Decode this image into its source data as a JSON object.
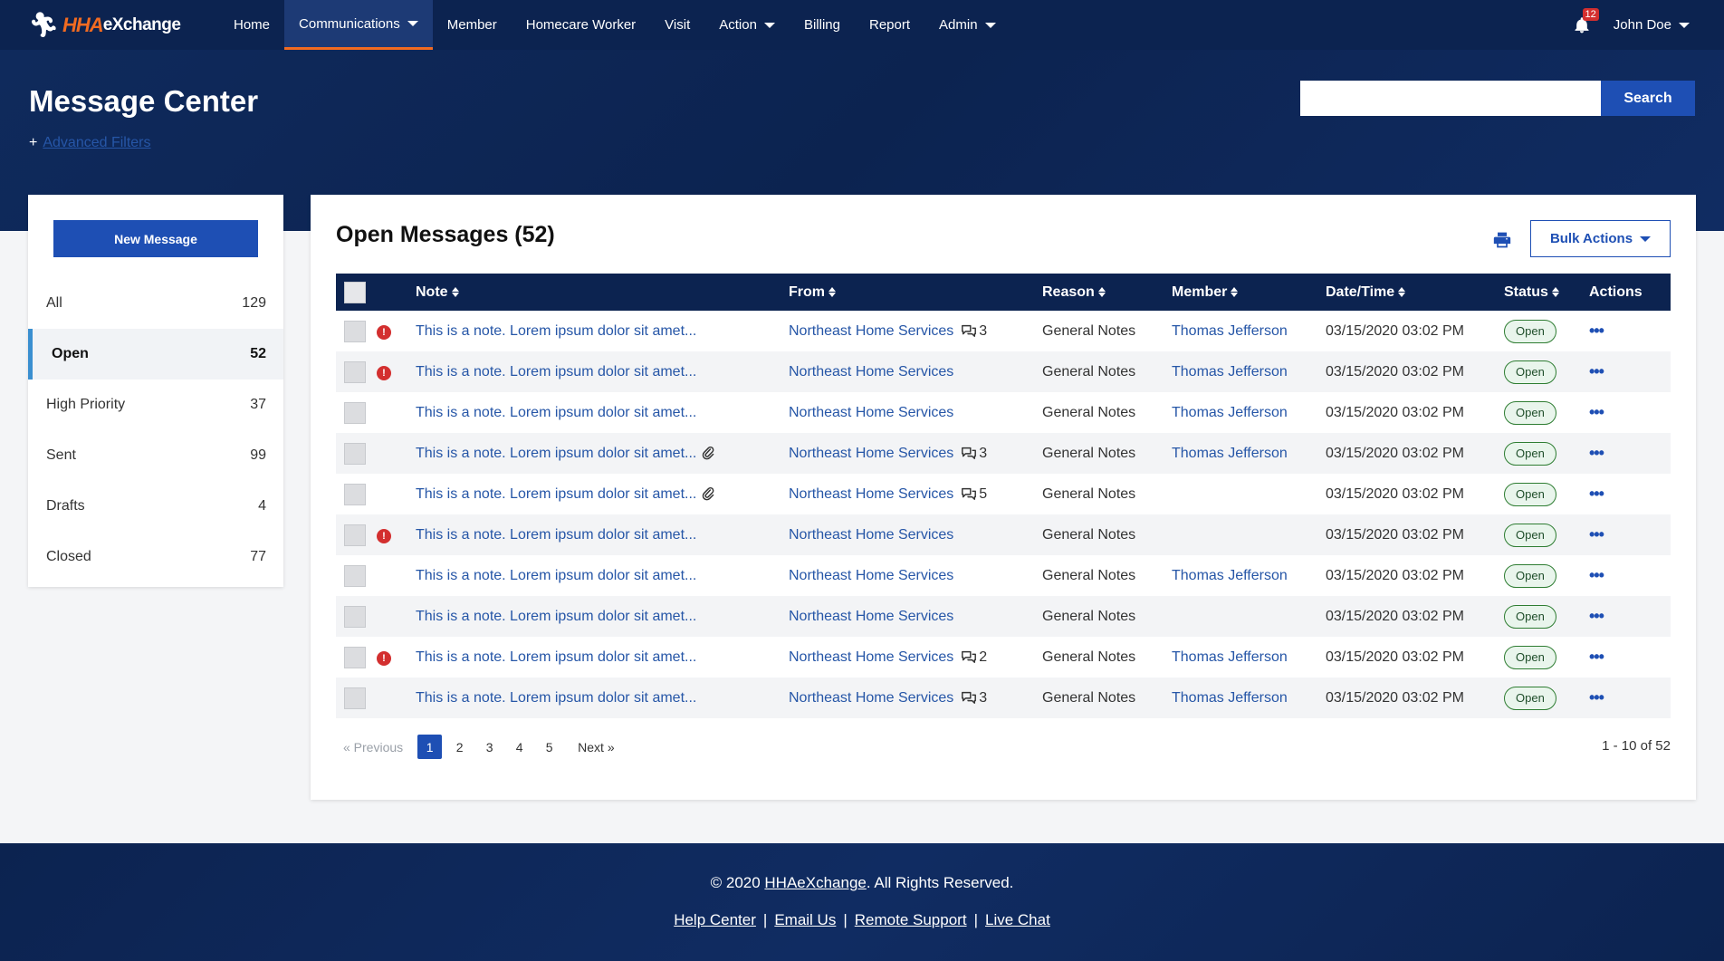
{
  "brand": {
    "part1": "HHA",
    "part2": "eXchange"
  },
  "nav": {
    "items": [
      {
        "label": "Home"
      },
      {
        "label": "Communications",
        "caret": true,
        "active": true
      },
      {
        "label": "Member"
      },
      {
        "label": "Homecare Worker"
      },
      {
        "label": "Visit"
      },
      {
        "label": "Action",
        "caret": true
      },
      {
        "label": "Billing"
      },
      {
        "label": "Report"
      },
      {
        "label": "Admin",
        "caret": true
      }
    ],
    "notifications": "12",
    "user": "John Doe"
  },
  "hero": {
    "title": "Message Center",
    "filters_prefix": "+",
    "filters_label": "Advanced Filters",
    "search_placeholder": "",
    "search_label": "Search"
  },
  "sidebar": {
    "new_message": "New Message",
    "items": [
      {
        "label": "All",
        "count": "129"
      },
      {
        "label": "Open",
        "count": "52",
        "active": true
      },
      {
        "label": "High Priority",
        "count": "37"
      },
      {
        "label": "Sent",
        "count": "99"
      },
      {
        "label": "Drafts",
        "count": "4"
      },
      {
        "label": "Closed",
        "count": "77"
      }
    ]
  },
  "panel": {
    "title": "Open Messages (52)",
    "bulk_actions": "Bulk Actions",
    "columns": {
      "note": "Note",
      "from": "From",
      "reason": "Reason",
      "member": "Member",
      "datetime": "Date/Time",
      "status": "Status",
      "actions": "Actions"
    },
    "rows": [
      {
        "priority": true,
        "note": "This is a note. Lorem ipsum dolor sit amet...",
        "attach": false,
        "from": "Northeast Home Services",
        "comments": "3",
        "reason": "General Notes",
        "member": "Thomas Jefferson",
        "datetime": "03/15/2020 03:02 PM",
        "status": "Open"
      },
      {
        "priority": true,
        "note": "This is a note. Lorem ipsum dolor sit amet...",
        "attach": false,
        "from": "Northeast Home Services",
        "comments": "",
        "reason": "General Notes",
        "member": "Thomas Jefferson",
        "datetime": "03/15/2020 03:02 PM",
        "status": "Open"
      },
      {
        "priority": false,
        "note": "This is a note. Lorem ipsum dolor sit amet...",
        "attach": false,
        "from": "Northeast Home Services",
        "comments": "",
        "reason": "General Notes",
        "member": "Thomas Jefferson",
        "datetime": "03/15/2020 03:02 PM",
        "status": "Open"
      },
      {
        "priority": false,
        "note": "This is a note. Lorem ipsum dolor sit amet...",
        "attach": true,
        "from": "Northeast Home Services",
        "comments": "3",
        "reason": "General Notes",
        "member": "Thomas Jefferson",
        "datetime": "03/15/2020 03:02 PM",
        "status": "Open"
      },
      {
        "priority": false,
        "note": "This is a note. Lorem ipsum dolor sit amet...",
        "attach": true,
        "from": "Northeast Home Services",
        "comments": "5",
        "reason": "General Notes",
        "member": "",
        "datetime": "03/15/2020 03:02 PM",
        "status": "Open"
      },
      {
        "priority": true,
        "note": "This is a note. Lorem ipsum dolor sit amet...",
        "attach": false,
        "from": "Northeast Home Services",
        "comments": "",
        "reason": "General Notes",
        "member": "",
        "datetime": "03/15/2020 03:02 PM",
        "status": "Open"
      },
      {
        "priority": false,
        "note": "This is a note. Lorem ipsum dolor sit amet...",
        "attach": false,
        "from": "Northeast Home Services",
        "comments": "",
        "reason": "General Notes",
        "member": "Thomas Jefferson",
        "datetime": "03/15/2020 03:02 PM",
        "status": "Open"
      },
      {
        "priority": false,
        "note": "This is a note. Lorem ipsum dolor sit amet...",
        "attach": false,
        "from": "Northeast Home Services",
        "comments": "",
        "reason": "General Notes",
        "member": "",
        "datetime": "03/15/2020 03:02 PM",
        "status": "Open"
      },
      {
        "priority": true,
        "note": "This is a note. Lorem ipsum dolor sit amet...",
        "attach": false,
        "from": "Northeast Home Services",
        "comments": "2",
        "reason": "General Notes",
        "member": "Thomas Jefferson",
        "datetime": "03/15/2020 03:02 PM",
        "status": "Open"
      },
      {
        "priority": false,
        "note": "This is a note. Lorem ipsum dolor sit amet...",
        "attach": false,
        "from": "Northeast Home Services",
        "comments": "3",
        "reason": "General Notes",
        "member": "Thomas Jefferson",
        "datetime": "03/15/2020 03:02 PM",
        "status": "Open"
      }
    ],
    "pagination": {
      "prev": "« Previous",
      "pages": [
        "1",
        "2",
        "3",
        "4",
        "5"
      ],
      "current": "1",
      "next": "Next »",
      "range": "1 - 10 of 52"
    }
  },
  "footer": {
    "copy_prefix": "© 2020 ",
    "copy_link": "HHAeXchange",
    "copy_suffix": ". All Rights Reserved.",
    "links": [
      "Help Center",
      "Email Us",
      "Remote Support",
      "Live Chat"
    ]
  },
  "colors": {
    "navy": "#0c2350",
    "accent_orange": "#f26b21",
    "primary_blue": "#1e4fb4",
    "link_blue": "#2656a7",
    "priority_red": "#d32f2f",
    "status_green": "#2e7d32"
  },
  "icons": {
    "brand": "person-figure-icon",
    "notifications": "bell-icon",
    "print": "printer-icon",
    "priority": "exclamation-circle-icon",
    "attachment": "paperclip-icon",
    "comments": "chat-bubbles-icon",
    "actions": "ellipsis-icon"
  }
}
